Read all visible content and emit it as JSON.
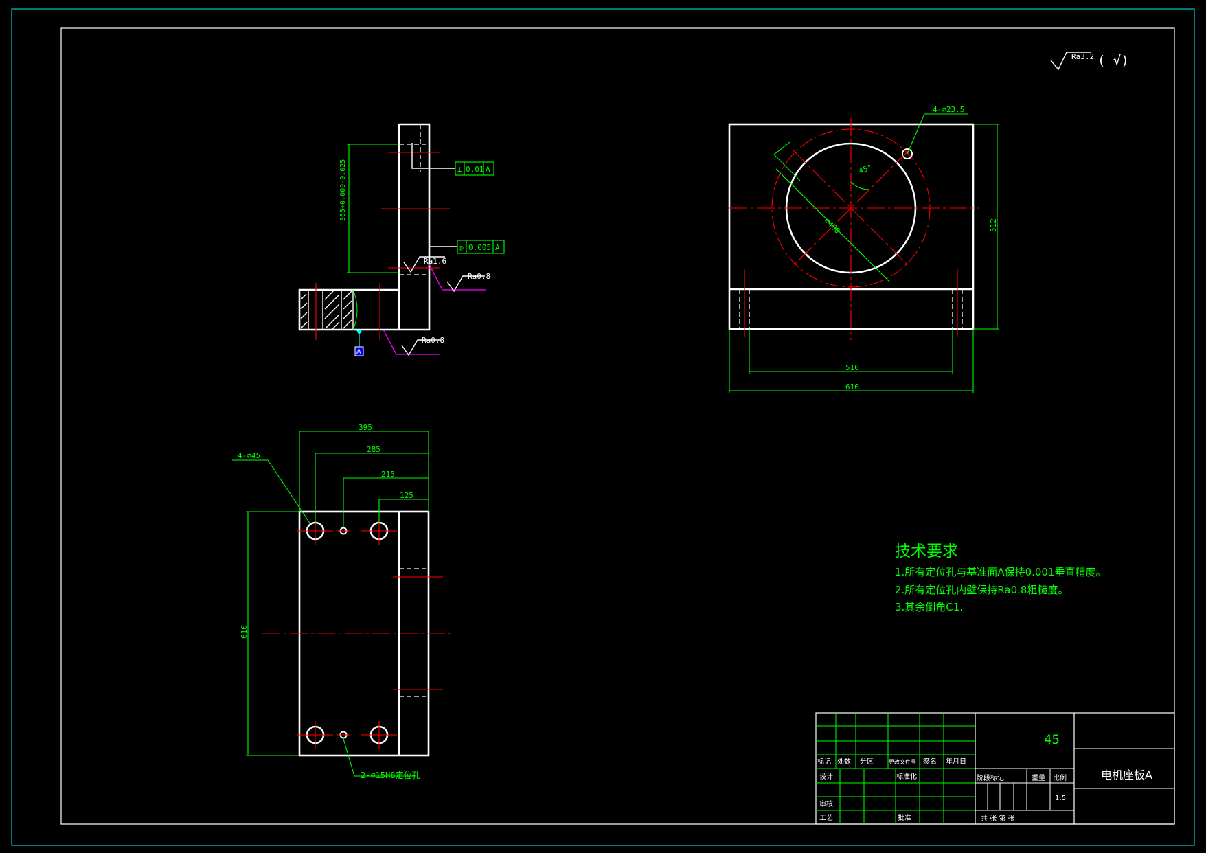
{
  "roughness_general": "Ra3.2",
  "roughness_general_suffix": "( √)",
  "side_view": {
    "tolerance_1": {
      "symbol": "⊥",
      "value": "0.01",
      "datum": "A"
    },
    "tolerance_2": {
      "symbol": "◎",
      "value": "0.005",
      "datum": "A"
    },
    "height_dim": "365+0.009-0.025",
    "roughness_1": "Ra1.6",
    "roughness_2": "Ra0.8",
    "roughness_3": "Ra0.8",
    "datum_label": "A"
  },
  "front_view": {
    "hole_callout": "4-∅23.5",
    "bore_dim": "∅400",
    "angle": "45°",
    "height_dim": "512",
    "inner_width_dim": "510",
    "outer_width_dim": "610"
  },
  "top_view": {
    "dims": [
      "395",
      "285",
      "215",
      "125"
    ],
    "hole_callout": "4-∅45",
    "length_dim": "610",
    "pin_callout": "2-∅15H8定位孔"
  },
  "tech_req": {
    "title": "技术要求",
    "items": [
      "1.所有定位孔与基准面A保持0.001垂直精度。",
      "2.所有定位孔内壁保持Ra0.8粗糙度。",
      "3.其余倒角C1."
    ]
  },
  "title_block": {
    "material": "45",
    "part_name": "电机座板A",
    "scale": "1:5",
    "header_row": [
      "标记",
      "处数",
      "分区",
      "更改文件号",
      "签名",
      "年月日"
    ],
    "designer": "设计",
    "standardized": "标准化",
    "reviewer": "审核",
    "process": "工艺",
    "approved": "批准",
    "stage_label": "阶段标记",
    "weight_label": "重量",
    "scale_label": "比例",
    "sheet_label": "共  张  第  张"
  },
  "colors": {
    "geometry": "#ffffff",
    "dimension": "#00ff00",
    "centerline": "#ff0000",
    "roughness_leader": "#ff00ff",
    "frame": "#00cccc"
  }
}
